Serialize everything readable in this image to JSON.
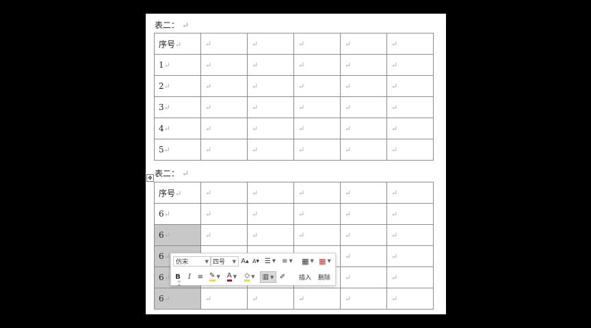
{
  "doc": {
    "caption1": "表二：",
    "caption2": "表二：",
    "return_mark": "↵",
    "table1": {
      "rows": [
        [
          "序号",
          "",
          "",
          "",
          "",
          ""
        ],
        [
          "1",
          "",
          "",
          "",
          "",
          ""
        ],
        [
          "2",
          "",
          "",
          "",
          "",
          ""
        ],
        [
          "3",
          "",
          "",
          "",
          "",
          ""
        ],
        [
          "4",
          "",
          "",
          "",
          "",
          ""
        ],
        [
          "5",
          "",
          "",
          "",
          "",
          ""
        ]
      ]
    },
    "table2": {
      "rows": [
        [
          "序号",
          "",
          "",
          "",
          "",
          ""
        ],
        [
          "6",
          "",
          "",
          "",
          "",
          ""
        ],
        [
          "6",
          "",
          "",
          "",
          "",
          ""
        ],
        [
          "6",
          "",
          "",
          "",
          "",
          ""
        ],
        [
          "6",
          "",
          "",
          "",
          "",
          ""
        ],
        [
          "6",
          "",
          "",
          "",
          "",
          ""
        ]
      ],
      "selected_first_col_rows": [
        2,
        3,
        4,
        5
      ]
    }
  },
  "toolbar": {
    "font_name": "仿宋",
    "font_size": "四号",
    "grow_font": "A",
    "shrink_font": "A",
    "bold": "B",
    "italic": "I",
    "font_color_letter": "A",
    "insert_label": "插入",
    "delete_label": "删除"
  },
  "colors": {
    "highlight": "#f5e400",
    "font_color": "#d0021b",
    "selection": "#c8c8c8"
  }
}
